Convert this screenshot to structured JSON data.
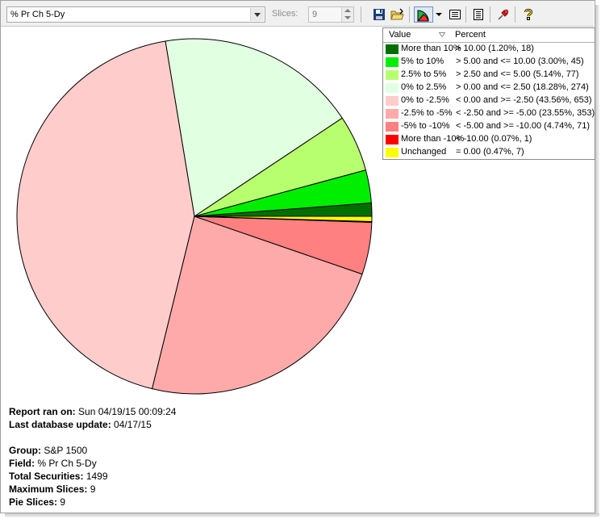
{
  "toolbar": {
    "field_value": "% Pr Ch 5-Dy",
    "slices_label": "Slices:",
    "slices_value": "9"
  },
  "legend": {
    "col_value": "Value",
    "col_percent": "Percent",
    "rows": [
      {
        "label": "More than 10%",
        "range": "> 10.00 (1.20%, 18)",
        "color": "#006f00"
      },
      {
        "label": "5% to 10%",
        "range": "> 5.00 and <= 10.00 (3.00%, 45)",
        "color": "#00ee00"
      },
      {
        "label": "2.5% to 5%",
        "range": "> 2.50 and <= 5.00 (5.14%, 77)",
        "color": "#b8ff70"
      },
      {
        "label": "0% to 2.5%",
        "range": "> 0.00 and <= 2.50 (18.28%, 274)",
        "color": "#e1ffe1"
      },
      {
        "label": "0% to -2.5%",
        "range": "< 0.00 and >= -2.50 (43.56%, 653)",
        "color": "#ffcccc"
      },
      {
        "label": "-2.5% to -5%",
        "range": "< -2.50 and >= -5.00 (23.55%, 353)",
        "color": "#ffaaaa"
      },
      {
        "label": "-5% to -10%",
        "range": "< -5.00 and >= -10.00 (4.74%, 71)",
        "color": "#ff8080"
      },
      {
        "label": "More than -10%",
        "range": "< -10.00 (0.07%, 1)",
        "color": "#ff0000"
      },
      {
        "label": "Unchanged",
        "range": "= 0.00 (0.47%, 7)",
        "color": "#ffff00"
      }
    ]
  },
  "chart_data": {
    "type": "pie",
    "categories": [
      "More than 10%",
      "5% to 10%",
      "2.5% to 5%",
      "0% to 2.5%",
      "0% to -2.5%",
      "-2.5% to -5%",
      "-5% to -10%",
      "More than -10%",
      "Unchanged"
    ],
    "values": [
      1.2,
      3.0,
      5.14,
      18.28,
      43.56,
      23.55,
      4.74,
      0.07,
      0.47
    ],
    "counts": [
      18,
      45,
      77,
      274,
      653,
      353,
      71,
      1,
      7
    ],
    "colors": [
      "#006f00",
      "#00ee00",
      "#b8ff70",
      "#e1ffe1",
      "#ffcccc",
      "#ffaaaa",
      "#ff8080",
      "#ff0000",
      "#ffff00"
    ],
    "start_angle_deg": 0,
    "direction": "counterclockwise",
    "legend_position": "top-right"
  },
  "info": {
    "report_ran_label": "Report ran on:",
    "report_ran_value": "Sun 04/19/15 00:09:24",
    "db_update_label": "Last database update:",
    "db_update_value": "04/17/15",
    "group_label": "Group:",
    "group_value": "S&P 1500",
    "field_label": "Field:",
    "field_value": "% Pr Ch 5-Dy",
    "total_label": "Total Securities:",
    "total_value": "1499",
    "max_slices_label": "Maximum Slices:",
    "max_slices_value": "9",
    "pie_slices_label": "Pie Slices:",
    "pie_slices_value": "9"
  },
  "icons": [
    "save-icon",
    "open-folder-icon",
    "pie-chart-icon",
    "list-icon",
    "report-icon",
    "pin-icon",
    "help-icon"
  ]
}
